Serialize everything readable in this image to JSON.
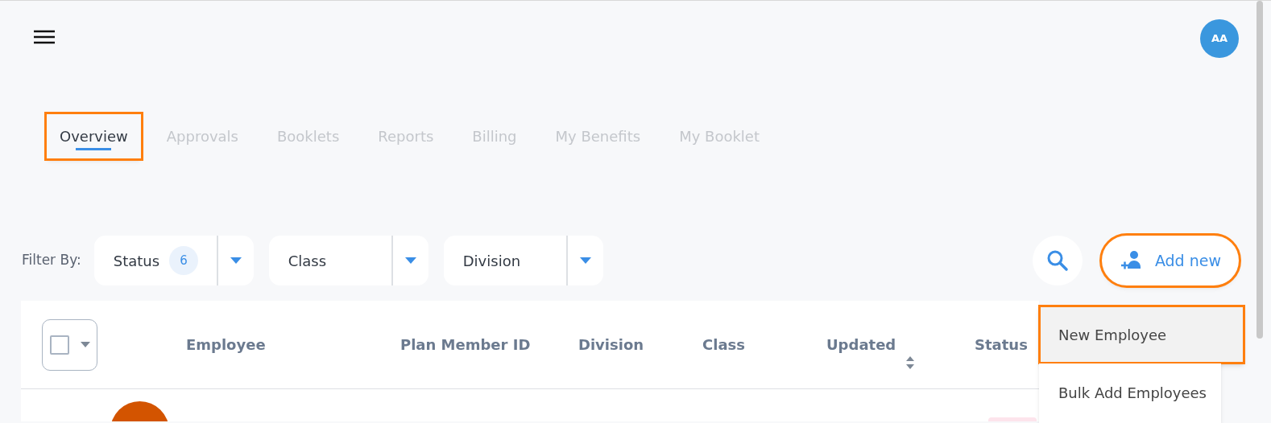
{
  "header": {
    "avatar_initials": "AA"
  },
  "tabs": [
    {
      "label": "Overview",
      "selected": true,
      "highlighted": true
    },
    {
      "label": "Approvals",
      "selected": false,
      "highlighted": false
    },
    {
      "label": "Booklets",
      "selected": false,
      "highlighted": false
    },
    {
      "label": "Reports",
      "selected": false,
      "highlighted": false
    },
    {
      "label": "Billing",
      "selected": false,
      "highlighted": false
    },
    {
      "label": "My Benefits",
      "selected": false,
      "highlighted": false
    },
    {
      "label": "My Booklet",
      "selected": false,
      "highlighted": false
    }
  ],
  "filter_label": "Filter By:",
  "filters": [
    {
      "label": "Status",
      "count": "6"
    },
    {
      "label": "Class"
    },
    {
      "label": "Division"
    }
  ],
  "add_button": {
    "label": "Add new",
    "highlighted": true
  },
  "add_menu": [
    {
      "label": "New Employee",
      "hovered": true,
      "highlighted": true
    },
    {
      "label": "Bulk Add Employees",
      "hovered": false,
      "highlighted": false
    }
  ],
  "table": {
    "select_all_checked": false,
    "columns": [
      {
        "label": "Employee",
        "sortable": false
      },
      {
        "label": "Plan Member ID",
        "sortable": false
      },
      {
        "label": "Division",
        "sortable": false
      },
      {
        "label": "Class",
        "sortable": false
      },
      {
        "label": "Updated",
        "sortable": true
      },
      {
        "label": "Status",
        "sortable": false
      }
    ]
  }
}
